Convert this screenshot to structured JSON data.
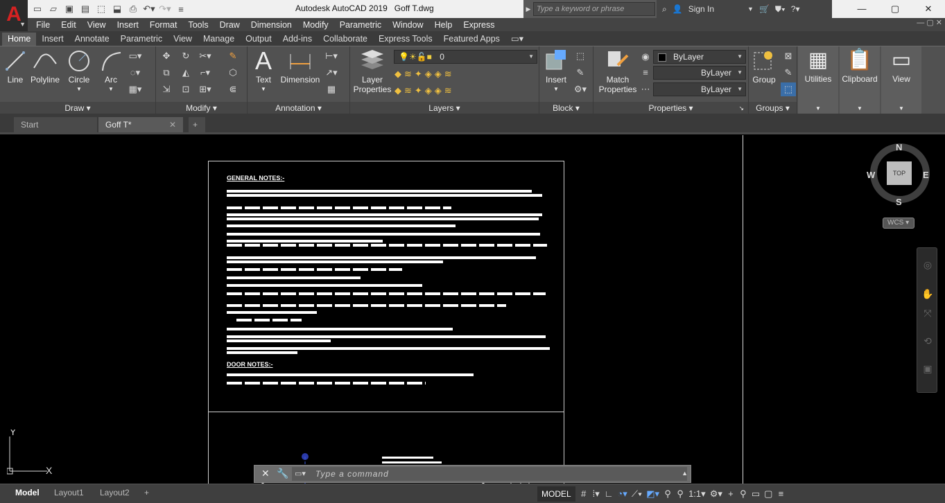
{
  "window": {
    "title": "Autodesk AutoCAD 2019",
    "filename": "Goff T.dwg",
    "controls": [
      "—",
      "▢",
      "✕"
    ]
  },
  "app_logo": "A",
  "search": {
    "placeholder": "Type a keyword or phrase"
  },
  "user": {
    "sign_in": "Sign In"
  },
  "menu": [
    "File",
    "Edit",
    "View",
    "Insert",
    "Format",
    "Tools",
    "Draw",
    "Dimension",
    "Modify",
    "Parametric",
    "Window",
    "Help",
    "Express"
  ],
  "ribbon_tabs": [
    "Home",
    "Insert",
    "Annotate",
    "Parametric",
    "View",
    "Manage",
    "Output",
    "Add-ins",
    "Collaborate",
    "Express Tools",
    "Featured Apps"
  ],
  "active_tab": "Home",
  "draw": {
    "title": "Draw",
    "line": "Line",
    "polyline": "Polyline",
    "circle": "Circle",
    "arc": "Arc"
  },
  "modify": {
    "title": "Modify"
  },
  "annotation": {
    "title": "Annotation",
    "text": "Text",
    "dimension": "Dimension"
  },
  "layers": {
    "title": "Layers",
    "current_layer": "0",
    "layer_properties_1": "Layer",
    "layer_properties_2": "Properties"
  },
  "block": {
    "title": "Block",
    "insert": "Insert"
  },
  "properties": {
    "title": "Properties",
    "match_1": "Match",
    "match_2": "Properties",
    "color": "ByLayer",
    "linetype": "ByLayer",
    "lineweight": "ByLayer"
  },
  "groups": {
    "title": "Groups",
    "group": "Group"
  },
  "utilities": "Utilities",
  "clipboard": "Clipboard",
  "view": "View",
  "doc_tabs": {
    "start": "Start",
    "active": "Goff T*"
  },
  "drawing": {
    "general_notes": "GENERAL NOTES:-",
    "door_notes": "DOOR NOTES:-"
  },
  "viewcube": {
    "n": "N",
    "s": "S",
    "e": "E",
    "w": "W",
    "top": "TOP",
    "wcs": "WCS"
  },
  "ucs": {
    "x": "X",
    "y": "Y"
  },
  "command": {
    "placeholder": "Type a command"
  },
  "layout_tabs": [
    "Model",
    "Layout1",
    "Layout2"
  ],
  "status": {
    "model": "MODEL",
    "scale": "1:1"
  }
}
